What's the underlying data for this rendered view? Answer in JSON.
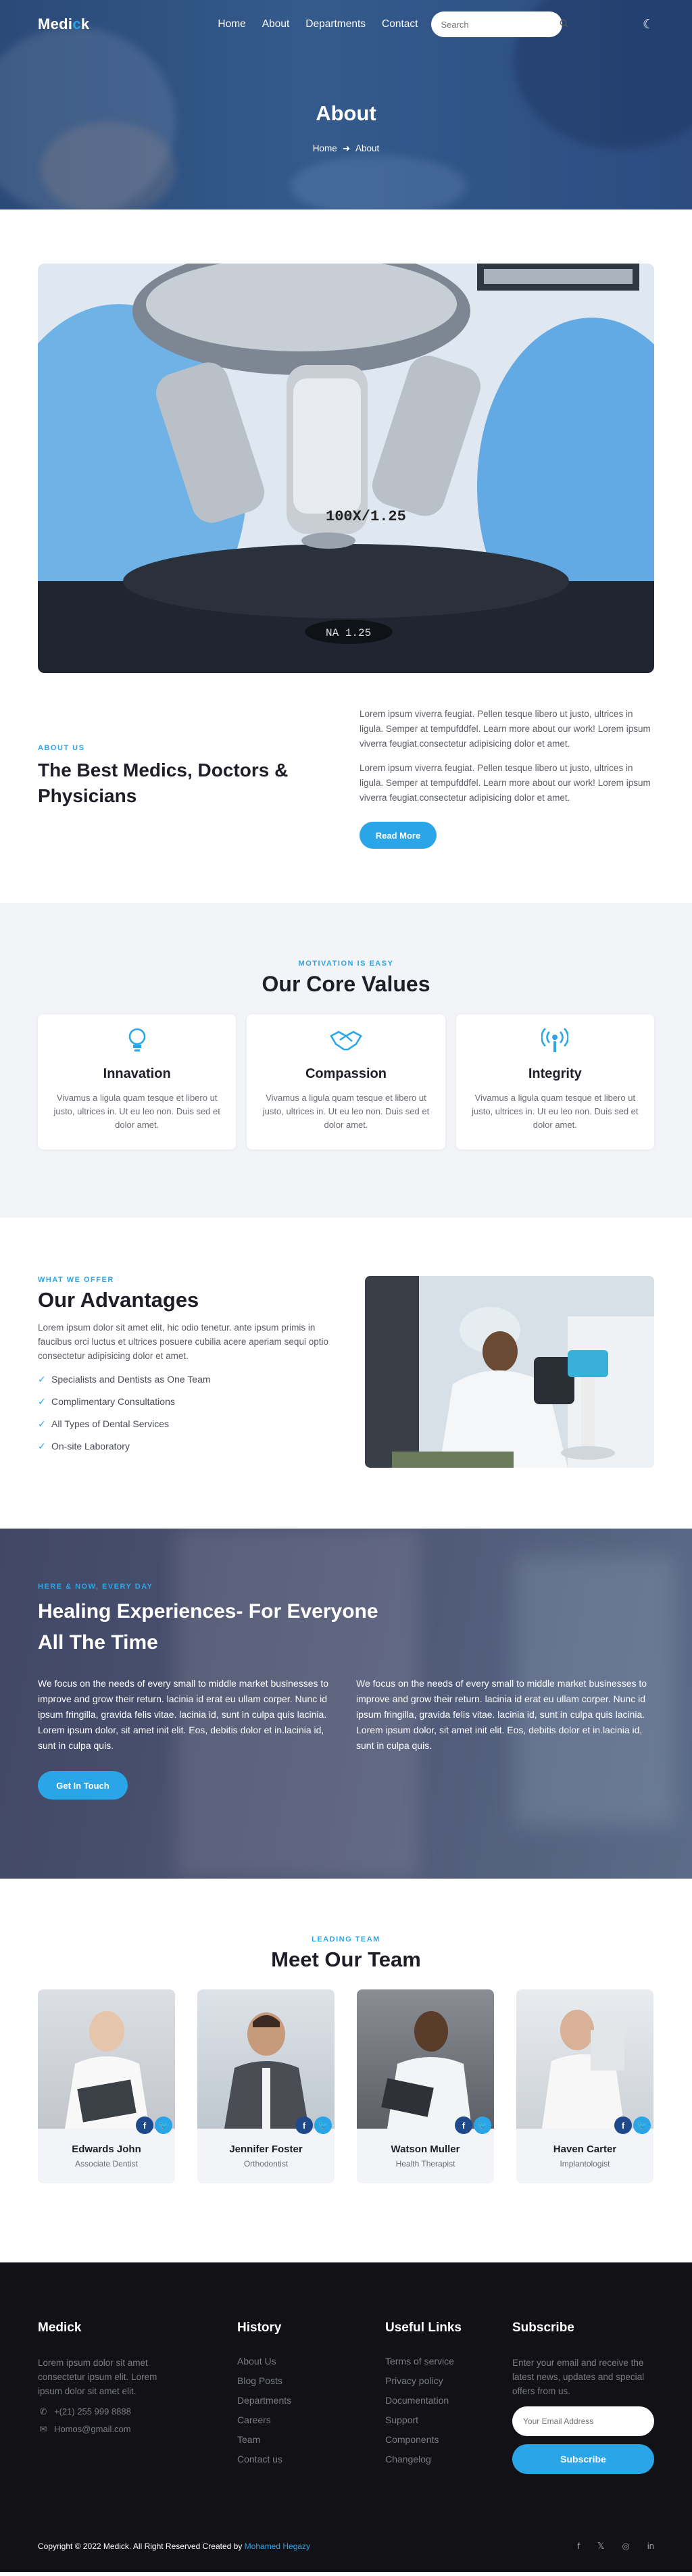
{
  "nav": {
    "brand_prefix": "Medi",
    "brand_dot": "c",
    "brand_suffix": "k",
    "links": [
      "Home",
      "About",
      "Departments",
      "Contact"
    ],
    "search_placeholder": "Search"
  },
  "hero": {
    "title": "About",
    "crumb_home": "Home",
    "crumb_current": "About"
  },
  "about": {
    "microscope_text": "100X/1.25",
    "microscope_text2": "NA 1.25",
    "eyebrow": "ABOUT US",
    "title": "The Best Medics, Doctors & Physicians",
    "para1": "Lorem ipsum viverra feugiat. Pellen tesque libero ut justo, ultrices in ligula. Semper at tempufddfel. Learn more about our work! Lorem ipsum viverra feugiat.consectetur adipisicing dolor et amet.",
    "para2": "Lorem ipsum viverra feugiat. Pellen tesque libero ut justo, ultrices in ligula. Semper at tempufddfel. Learn more about our work! Lorem ipsum viverra feugiat.consectetur adipisicing dolor et amet.",
    "button": "Read More"
  },
  "values": {
    "eyebrow": "MOTIVATION IS EASY",
    "title": "Our Core Values",
    "cards": [
      {
        "title": "Innavation",
        "text": "Vivamus a ligula quam tesque et libero ut justo, ultrices in. Ut eu leo non. Duis sed et dolor amet.",
        "icon": "lightbulb-icon"
      },
      {
        "title": "Compassion",
        "text": "Vivamus a ligula quam tesque et libero ut justo, ultrices in. Ut eu leo non. Duis sed et dolor amet.",
        "icon": "handshake-icon"
      },
      {
        "title": "Integrity",
        "text": "Vivamus a ligula quam tesque et libero ut justo, ultrices in. Ut eu leo non. Duis sed et dolor amet.",
        "icon": "broadcast-icon"
      }
    ]
  },
  "advantages": {
    "eyebrow": "WHAT WE OFFER",
    "title": "Our Advantages",
    "text": "Lorem ipsum dolor sit amet elit, hic odio tenetur. ante ipsum primis in faucibus orci luctus et ultrices posuere cubilia acere aperiam sequi optio consectetur adipisicing dolor et amet.",
    "items": [
      "Specialists and Dentists as One Team",
      "Complimentary Consultations",
      "All Types of Dental Services",
      "On-site Laboratory"
    ]
  },
  "healing": {
    "eyebrow": "HERE & NOW, EVERY DAY",
    "title_line1": "Healing Experiences- For Everyone",
    "title_line2": "All The Time",
    "para1": "We focus on the needs of every small to middle market businesses to improve and grow their return. lacinia id erat eu ullam corper. Nunc id ipsum fringilla, gravida felis vitae. lacinia id, sunt in culpa quis lacinia. Lorem ipsum dolor, sit amet init elit. Eos, debitis dolor et in.lacinia id, sunt in culpa quis.",
    "para2": "We focus on the needs of every small to middle market businesses to improve and grow their return. lacinia id erat eu ullam corper. Nunc id ipsum fringilla, gravida felis vitae. lacinia id, sunt in culpa quis lacinia. Lorem ipsum dolor, sit amet init elit. Eos, debitis dolor et in.lacinia id, sunt in culpa quis.",
    "button": "Get In Touch"
  },
  "team": {
    "eyebrow": "LEADING TEAM",
    "title": "Meet Our Team",
    "members": [
      {
        "name": "Edwards John",
        "role": "Associate Dentist"
      },
      {
        "name": "Jennifer Foster",
        "role": "Orthodontist"
      },
      {
        "name": "Watson Muller",
        "role": "Health Therapist"
      },
      {
        "name": "Haven Carter",
        "role": "Implantologist"
      }
    ]
  },
  "footer": {
    "brand": "Medick",
    "about": "Lorem ipsum dolor sit amet consectetur ipsum elit. Lorem ipsum dolor sit amet elit.",
    "phone": "+(21) 255 999 8888",
    "email": "Homos@gmail.com",
    "history_title": "History",
    "history_links": [
      "About Us",
      "Blog Posts",
      "Departments",
      "Careers",
      "Team",
      "Contact us"
    ],
    "useful_title": "Useful Links",
    "useful_links": [
      "Terms of service",
      "Privacy policy",
      "Documentation",
      "Support",
      "Components",
      "Changelog"
    ],
    "subscribe_title": "Subscribe",
    "subscribe_text": "Enter your email and receive the latest news, updates and special offers from us.",
    "email_placeholder": "Your Email Address",
    "subscribe_button": "Subscribe",
    "copyright": "Copyright © 2022 Medick. All Right Reserved Created by",
    "author": "Mohamed Hegazy",
    "social": [
      "f",
      "𝕏",
      "◎",
      "in"
    ]
  },
  "colors": {
    "accent": "#2aa5e8",
    "dark": "#121216",
    "hero": "#2a4a78"
  }
}
